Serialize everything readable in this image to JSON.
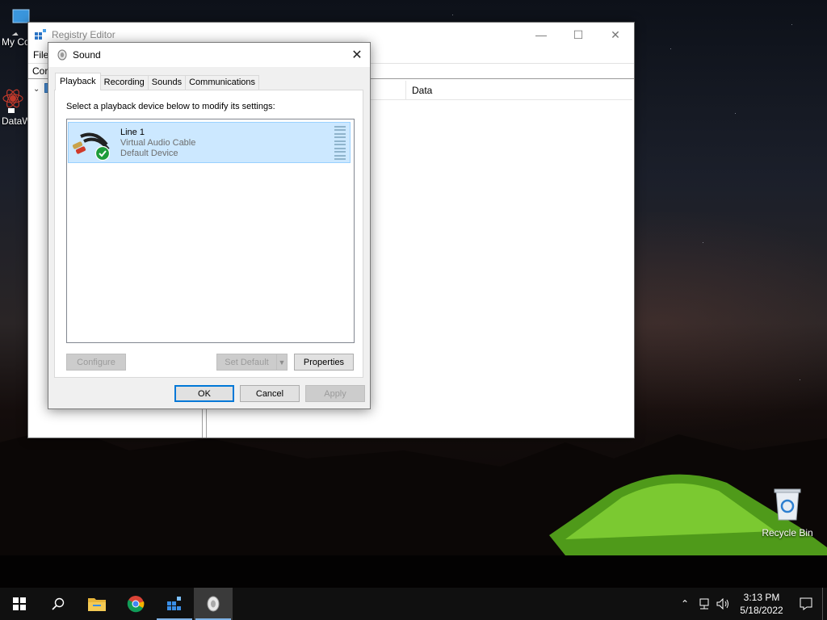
{
  "desktop": {
    "icons": [
      {
        "label": "My Co"
      },
      {
        "label": "DataW"
      },
      {
        "label": "Recycle Bin"
      }
    ]
  },
  "regedit": {
    "title": "Registry Editor",
    "menu_label": "File",
    "address_text": "Cor",
    "column_data": "Data",
    "controls": {
      "minimize": "—",
      "maximize": "☐",
      "close": "✕"
    }
  },
  "dialog": {
    "title": "Sound",
    "close_glyph": "✕",
    "tabs": [
      {
        "label": "Playback",
        "active": true
      },
      {
        "label": "Recording",
        "active": false
      },
      {
        "label": "Sounds",
        "active": false
      },
      {
        "label": "Communications",
        "active": false
      }
    ],
    "instruction": "Select a playback device below to modify its settings:",
    "device": {
      "name": "Line 1",
      "description": "Virtual Audio Cable",
      "status": "Default Device",
      "icon": "audio-cable-icon",
      "badge": "default-check-icon"
    },
    "buttons": {
      "configure": "Configure",
      "set_default": "Set Default",
      "properties": "Properties",
      "ok": "OK",
      "cancel": "Cancel",
      "apply": "Apply"
    }
  },
  "taskbar": {
    "apps": [
      "start-icon",
      "search-icon",
      "file-explorer-icon",
      "chrome-icon",
      "registry-editor-icon",
      "sound-icon"
    ],
    "clock": {
      "time": "3:13 PM",
      "date": "5/18/2022"
    }
  },
  "colors": {
    "accent": "#0078d7",
    "selection": "#cce8ff",
    "taskbar": "#101010"
  }
}
